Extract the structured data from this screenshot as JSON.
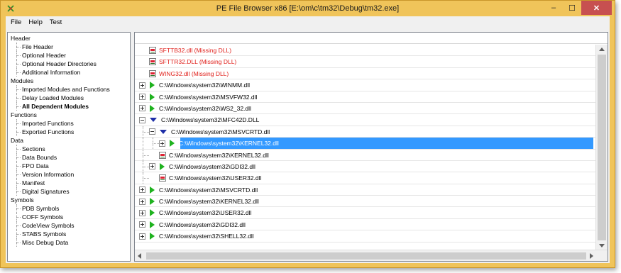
{
  "window": {
    "title": "PE File Browser x86 [E:\\om\\c\\tm32\\Debug\\tm32.exe]",
    "minimize_glyph": "‒",
    "maximize_glyph": "☐",
    "close_glyph": "✕",
    "frame_color": "#f0c45a",
    "close_color": "#c75050"
  },
  "menubar": [
    "File",
    "Help",
    "Test"
  ],
  "tree": [
    {
      "label": "Header",
      "level": 0
    },
    {
      "label": "File Header",
      "level": 1
    },
    {
      "label": "Optional Header",
      "level": 1
    },
    {
      "label": "Optional Header Directories",
      "level": 1
    },
    {
      "label": "Additional Information",
      "level": 1
    },
    {
      "label": "Modules",
      "level": 0
    },
    {
      "label": "Imported Modules and Functions",
      "level": 1
    },
    {
      "label": "Delay Loaded Modules",
      "level": 1
    },
    {
      "label": "All Dependent Modules",
      "level": 1,
      "selected": true
    },
    {
      "label": "Functions",
      "level": 0
    },
    {
      "label": "Imported Functions",
      "level": 1
    },
    {
      "label": "Exported Functions",
      "level": 1
    },
    {
      "label": "Data",
      "level": 0
    },
    {
      "label": "Sections",
      "level": 1
    },
    {
      "label": "Data Bounds",
      "level": 1
    },
    {
      "label": "FPO Data",
      "level": 1
    },
    {
      "label": "Version Information",
      "level": 1
    },
    {
      "label": "Manifest",
      "level": 1
    },
    {
      "label": "Digital Signatures",
      "level": 1
    },
    {
      "label": "Symbols",
      "level": 0
    },
    {
      "label": "PDB Symbols",
      "level": 1
    },
    {
      "label": "COFF Symbols",
      "level": 1
    },
    {
      "label": "CodeView Symbols",
      "level": 1
    },
    {
      "label": "STABS Symbols",
      "level": 1
    },
    {
      "label": "Misc Debug Data",
      "level": 1
    }
  ],
  "modules": [
    {
      "label": "SFTTB32.dll (Missing DLL)",
      "depth": 0,
      "kind": "missing"
    },
    {
      "label": "SFTTR32.DLL (Missing DLL)",
      "depth": 0,
      "kind": "missing"
    },
    {
      "label": "WING32.dll (Missing DLL)",
      "depth": 0,
      "kind": "missing"
    },
    {
      "label": "C:\\Windows\\system32\\WINMM.dll",
      "depth": 0,
      "kind": "collapsed"
    },
    {
      "label": "C:\\Windows\\system32\\MSVFW32.dll",
      "depth": 0,
      "kind": "collapsed"
    },
    {
      "label": "C:\\Windows\\system32\\WS2_32.dll",
      "depth": 0,
      "kind": "collapsed"
    },
    {
      "label": "C:\\Windows\\system32\\MFC42D.DLL",
      "depth": 0,
      "kind": "expanded"
    },
    {
      "label": "C:\\Windows\\system32\\MSVCRTD.dll",
      "depth": 1,
      "kind": "expanded"
    },
    {
      "label": "C:\\Windows\\system32\\KERNEL32.dll",
      "depth": 2,
      "kind": "collapsed",
      "selected": true
    },
    {
      "label": "C:\\Windows\\system32\\KERNEL32.dll",
      "depth": 1,
      "kind": "leaf"
    },
    {
      "label": "C:\\Windows\\system32\\GDI32.dll",
      "depth": 1,
      "kind": "collapsed"
    },
    {
      "label": "C:\\Windows\\system32\\USER32.dll",
      "depth": 1,
      "kind": "leaf"
    },
    {
      "label": "C:\\Windows\\system32\\MSVCRTD.dll",
      "depth": 0,
      "kind": "collapsed"
    },
    {
      "label": "C:\\Windows\\system32\\KERNEL32.dll",
      "depth": 0,
      "kind": "collapsed"
    },
    {
      "label": "C:\\Windows\\system32\\USER32.dll",
      "depth": 0,
      "kind": "collapsed"
    },
    {
      "label": "C:\\Windows\\system32\\GDI32.dll",
      "depth": 0,
      "kind": "collapsed"
    },
    {
      "label": "C:\\Windows\\system32\\SHELL32.dll",
      "depth": 0,
      "kind": "collapsed"
    }
  ],
  "colors": {
    "missing_text": "#e0201b",
    "selection": "#3399ff",
    "expand_arrow": "#1eb21e",
    "collapse_arrow": "#1f2fa8"
  }
}
